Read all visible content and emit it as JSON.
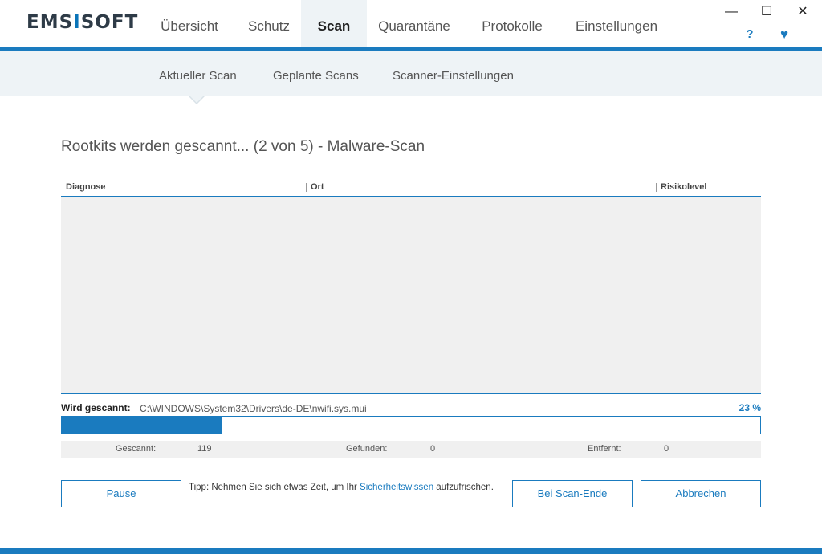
{
  "app": {
    "logo_part1": "EMS",
    "logo_part2": "I",
    "logo_part3": "SOFT"
  },
  "nav": {
    "tabs": [
      {
        "label": "Übersicht"
      },
      {
        "label": "Schutz"
      },
      {
        "label": "Scan",
        "active": true
      },
      {
        "label": "Quarantäne"
      },
      {
        "label": "Protokolle"
      },
      {
        "label": "Einstellungen"
      }
    ]
  },
  "window_controls": {
    "minimize": "—",
    "maximize": "☐",
    "close": "✕"
  },
  "header_icons": {
    "help": "?",
    "favorite": "♥"
  },
  "subnav": {
    "tabs": [
      {
        "label": "Aktueller Scan",
        "active": true
      },
      {
        "label": "Geplante Scans"
      },
      {
        "label": "Scanner-Einstellungen"
      }
    ]
  },
  "scan": {
    "title": "Rootkits werden gescannt... (2 von 5) - Malware-Scan",
    "columns": [
      "Diagnose",
      "Ort",
      "Risikolevel"
    ],
    "scanning_label": "Wird gescannt:",
    "scanning_path": "C:\\WINDOWS\\System32\\Drivers\\de-DE\\nwifi.sys.mui",
    "progress_text": "23 %",
    "progress_value": 23
  },
  "stats": {
    "scanned_label": "Gescannt:",
    "scanned_value": "119",
    "found_label": "Gefunden:",
    "found_value": "0",
    "removed_label": "Entfernt:",
    "removed_value": "0"
  },
  "buttons": {
    "pause": "Pause",
    "on_scan_end": "Bei Scan-Ende",
    "cancel": "Abbrechen"
  },
  "tip": {
    "prefix": "Tipp: Nehmen Sie sich etwas Zeit, um Ihr ",
    "link": "Sicherheitswissen",
    "suffix": " aufzufrischen."
  },
  "colors": {
    "accent": "#1a7bbf",
    "logo_dark": "#2e3b47"
  }
}
